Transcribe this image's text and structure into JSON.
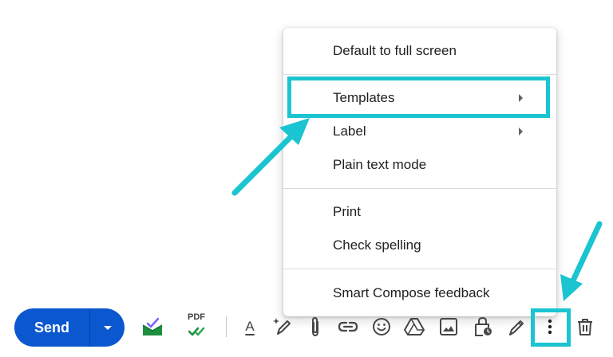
{
  "menu": {
    "items": [
      {
        "label": "Default to full screen"
      },
      {
        "label": "Templates",
        "has_submenu": true
      },
      {
        "label": "Label",
        "has_submenu": true
      },
      {
        "label": "Plain text mode"
      },
      {
        "label": "Print"
      },
      {
        "label": "Check spelling"
      },
      {
        "label": "Smart Compose feedback"
      }
    ],
    "highlighted_item": "Templates"
  },
  "toolbar": {
    "send_label": "Send",
    "pdf_label": "PDF",
    "format_letter": "A",
    "icons": [
      "envelope-check-icon",
      "pdf-icon",
      "format-text-icon",
      "ai-pen-icon",
      "attach-icon",
      "link-icon",
      "emoji-icon",
      "drive-icon",
      "photo-icon",
      "confidential-lock-icon",
      "signature-pen-icon",
      "more-options-icon",
      "trash-icon"
    ]
  },
  "colors": {
    "annotation": "#1ac4d0",
    "send_button": "#0b57d0",
    "menu_text": "#202124",
    "icon": "#444746"
  }
}
